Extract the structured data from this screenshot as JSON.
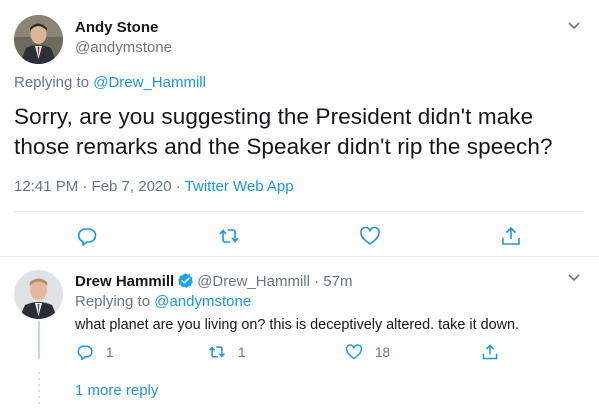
{
  "colors": {
    "text": "#14171a",
    "secondary": "#657786",
    "link": "#1b95e0",
    "border": "#e6ecf0",
    "icon": "#1b95e0",
    "verified": "#1da1f2"
  },
  "main_tweet": {
    "author_name": "Andy Stone",
    "author_handle": "@andymstone",
    "replying_prefix": "Replying to ",
    "replying_to": "@Drew_Hammill",
    "text": "Sorry, are you suggesting the President didn't make those remarks and the Speaker didn't rip the speech?",
    "timestamp": "12:41 PM · Feb 7, 2020 · ",
    "source": "Twitter Web App",
    "icons": [
      "reply-icon",
      "retweet-icon",
      "like-icon",
      "share-icon",
      "chevron-down-icon"
    ]
  },
  "reply_tweet": {
    "author_name": "Drew Hammill",
    "verified": true,
    "author_handle": "@Drew_Hammill",
    "separator": " · ",
    "time_ago": "57m",
    "replying_prefix": "Replying to ",
    "replying_to": "@andymstone",
    "text": "what planet are you living on?  this is deceptively altered.  take it down.",
    "reply_count": "1",
    "retweet_count": "1",
    "like_count": "18",
    "icons": [
      "reply-icon",
      "retweet-icon",
      "like-icon",
      "share-icon",
      "chevron-down-icon",
      "verified-badge-icon"
    ]
  },
  "more_replies_label": "1 more reply"
}
